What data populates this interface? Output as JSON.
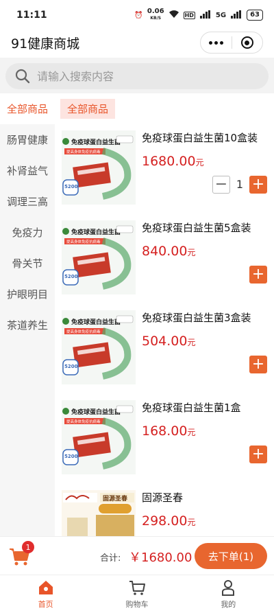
{
  "status_bar": {
    "time": "11:11",
    "speed": "0.06",
    "speed_unit": "KB/S",
    "battery": "63",
    "network": "5G"
  },
  "nav": {
    "title": "91健康商城"
  },
  "search": {
    "placeholder": "请输入搜索内容"
  },
  "sidebar": {
    "items": [
      {
        "label": "全部商品",
        "active": true
      },
      {
        "label": "肠胃健康"
      },
      {
        "label": "补肾益气"
      },
      {
        "label": "调理三高"
      },
      {
        "label": "免疫力"
      },
      {
        "label": "骨关节"
      },
      {
        "label": "护眼明目"
      },
      {
        "label": "茶道养生"
      }
    ]
  },
  "main": {
    "category_tag": "全部商品",
    "products": [
      {
        "name": "免疫球蛋白益生菌10盒装",
        "price": "1680.00",
        "unit": "元",
        "quantity": "1",
        "image_title": "免疫球蛋白益生菌",
        "image_sub": "提高身体免疫抗病毒",
        "badge": "5200"
      },
      {
        "name": "免疫球蛋白益生菌5盒装",
        "price": "840.00",
        "unit": "元",
        "image_title": "免疫球蛋白益生菌",
        "image_sub": "提高身体免疫抗病毒",
        "badge": "5200"
      },
      {
        "name": "免疫球蛋白益生菌3盒装",
        "price": "504.00",
        "unit": "元",
        "image_title": "免疫球蛋白益生菌",
        "image_sub": "提高身体免疫抗病毒",
        "badge": "5200"
      },
      {
        "name": "免疫球蛋白益生菌1盒",
        "price": "168.00",
        "unit": "元",
        "image_title": "免疫球蛋白益生菌",
        "image_sub": "提高身体免疫抗病毒",
        "badge": "5200"
      },
      {
        "name": "固源圣春",
        "price": "298.00",
        "unit": "元",
        "image_title": "固源圣春"
      }
    ]
  },
  "cart": {
    "badge": "1",
    "total_label": "合计:",
    "total_value": "￥1680.00",
    "checkout_label": "去下单(1)"
  },
  "tabbar": {
    "items": [
      {
        "label": "首页",
        "active": true
      },
      {
        "label": "购物车"
      },
      {
        "label": "我的"
      }
    ]
  },
  "colors": {
    "accent": "#e8662f",
    "price": "#d52121",
    "active_text": "#e8552a"
  }
}
